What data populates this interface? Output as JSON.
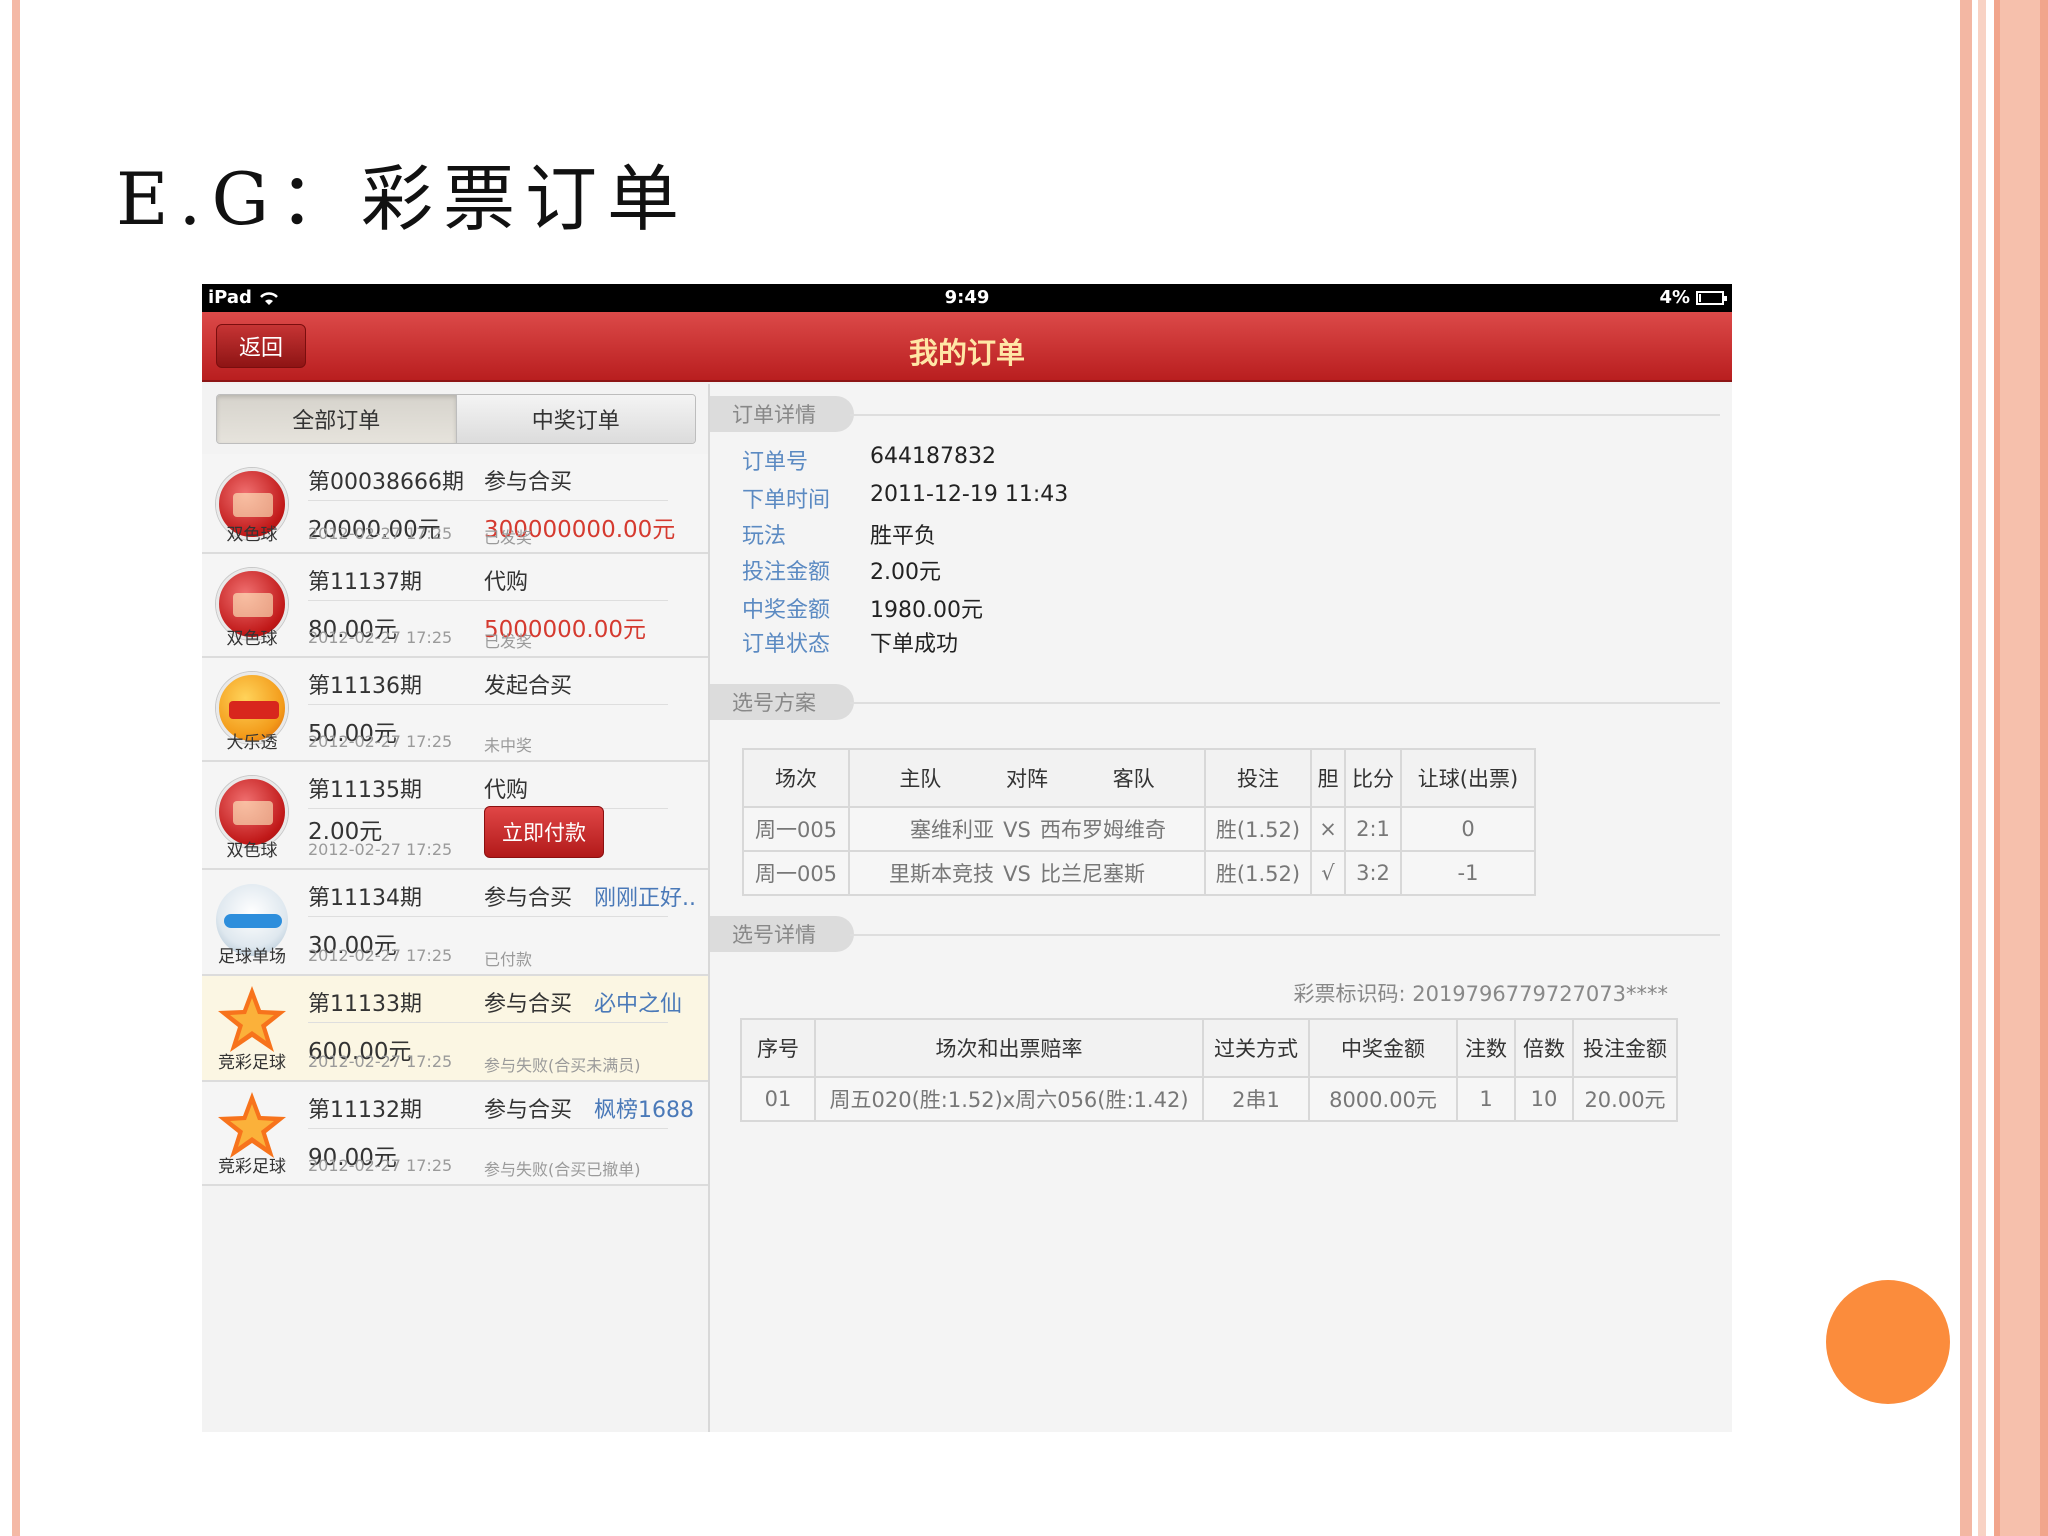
{
  "slide": {
    "title": "E.G：彩票订单"
  },
  "statusbar": {
    "device": "iPad",
    "time": "9:49",
    "battery": "4%",
    "battery_level": 0.04
  },
  "navbar": {
    "back_label": "返回",
    "title": "我的订单"
  },
  "tabs": [
    {
      "label": "全部订单",
      "active": true
    },
    {
      "label": "中奖订单",
      "active": false
    }
  ],
  "orders": [
    {
      "logo": "双色球-logo-icon",
      "lottery": "双色球",
      "period": "第00038666期",
      "type": "参与合买",
      "extra": "",
      "amount": "20000.00元",
      "prize": "300000000.00元",
      "date": "2012-02-27  17:25",
      "status": "已发奖",
      "pay_button": ""
    },
    {
      "logo": "双色球-logo-icon",
      "lottery": "双色球",
      "period": "第11137期",
      "type": "代购",
      "extra": "",
      "amount": "80.00元",
      "prize": "5000000.00元",
      "date": "2012-02-27  17:25",
      "status": "已发奖",
      "pay_button": ""
    },
    {
      "logo": "大乐透-logo-icon",
      "lottery": "大乐透",
      "period": "第11136期",
      "type": "发起合买",
      "extra": "",
      "amount": "50.00元",
      "prize": "",
      "date": "2012-02-27  17:25",
      "status": "未中奖",
      "pay_button": ""
    },
    {
      "logo": "双色球-logo-icon",
      "lottery": "双色球",
      "period": "第11135期",
      "type": "代购",
      "extra": "",
      "amount": "2.00元",
      "prize": "",
      "date": "2012-02-27  17:25",
      "status": "",
      "pay_button": "立即付款"
    },
    {
      "logo": "足球单场-logo-icon",
      "lottery": "足球单场",
      "period": "第11134期",
      "type": "参与合买",
      "extra": "刚刚正好..",
      "amount": "30.00元",
      "prize": "",
      "date": "2012-02-27  17:25",
      "status": "已付款",
      "pay_button": ""
    },
    {
      "logo": "竞彩足球-logo-icon",
      "lottery": "竞彩足球",
      "period": "第11133期",
      "type": "参与合买",
      "extra": "必中之仙",
      "amount": "600.00元",
      "prize": "",
      "date": "2012-02-27  17:25",
      "status": "参与失败(合买未满员)",
      "pay_button": ""
    },
    {
      "logo": "竞彩足球-logo-icon",
      "lottery": "竞彩足球",
      "period": "第11132期",
      "type": "参与合买",
      "extra": "枫榜1688",
      "amount": "90.00元",
      "prize": "",
      "date": "2012-02-27  17:25",
      "status": "参与失败(合买已撤单)",
      "pay_button": ""
    }
  ],
  "detail": {
    "section_title": "订单详情",
    "rows": [
      {
        "label": "订单号",
        "value": "644187832"
      },
      {
        "label": "下单时间",
        "value": "2011-12-19 11:43"
      },
      {
        "label": "玩法",
        "value": "胜平负"
      },
      {
        "label": "投注金额",
        "value": "2.00元"
      },
      {
        "label": "中奖金额",
        "value": "1980.00元"
      },
      {
        "label": "订单状态",
        "value": "下单成功"
      }
    ]
  },
  "plan": {
    "section_title": "选号方案",
    "headers": [
      "场次",
      "主队",
      "对阵",
      "客队",
      "投注",
      "胆",
      "比分",
      "让球(出票)"
    ],
    "rows": [
      {
        "match": "周一005",
        "home": "塞维利亚",
        "vs": "VS",
        "away": "西布罗姆维奇",
        "bet": "胜(1.52)",
        "dan": "×",
        "score": "2:1",
        "handicap": "0"
      },
      {
        "match": "周一005",
        "home": "里斯本竞技",
        "vs": "VS",
        "away": "比兰尼塞斯",
        "bet": "胜(1.52)",
        "dan": "√",
        "score": "3:2",
        "handicap": "-1"
      }
    ]
  },
  "pick_detail": {
    "section_title": "选号详情",
    "ticket_code": "彩票标识码: 2019796779727073****",
    "headers": [
      "序号",
      "场次和出票赔率",
      "过关方式",
      "中奖金额",
      "注数",
      "倍数",
      "投注金额"
    ],
    "rows": [
      {
        "no": "01",
        "matches": "周五020(胜:1.52)x周六056(胜:1.42)",
        "pass": "2串1",
        "win": "8000.00元",
        "count": "1",
        "multiple": "10",
        "stake": "20.00元"
      }
    ]
  },
  "colors": {
    "nav_red": "#c8302f",
    "prize_red": "#d53a2f",
    "label_blue": "#5b8ac2",
    "accent_orange": "#fb8c3c"
  }
}
